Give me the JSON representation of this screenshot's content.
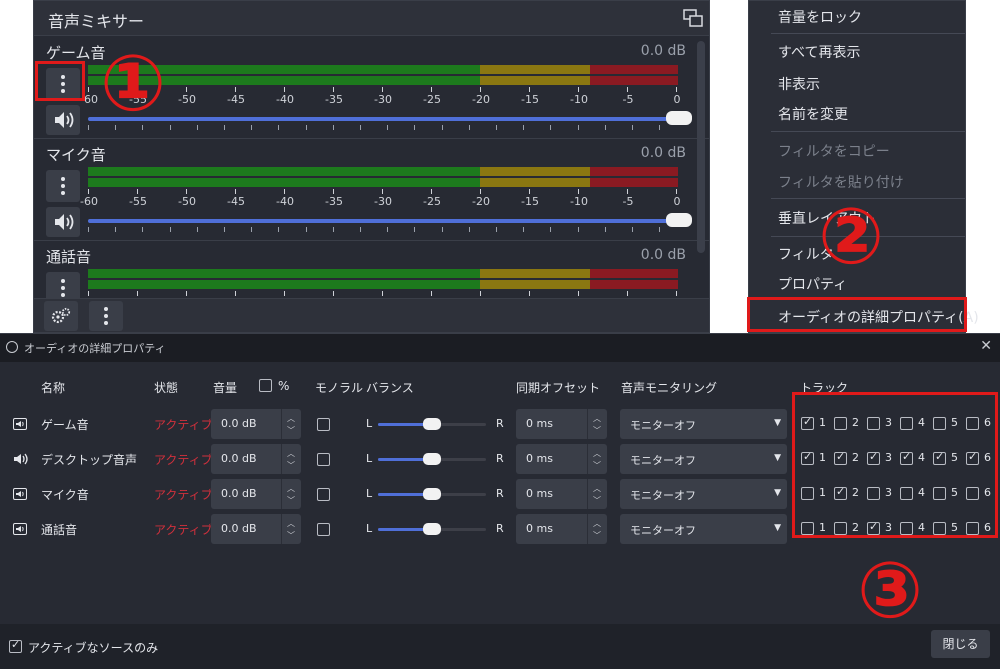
{
  "mixer": {
    "title": "音声ミキサー",
    "scale_labels": [
      "-60",
      "-55",
      "-50",
      "-45",
      "-40",
      "-35",
      "-30",
      "-25",
      "-20",
      "-15",
      "-10",
      "-5",
      "0"
    ],
    "channels": [
      {
        "name": "ゲーム音",
        "db": "0.0 dB",
        "volume_fraction": 1.0
      },
      {
        "name": "マイク音",
        "db": "0.0 dB",
        "volume_fraction": 1.0
      },
      {
        "name": "通話音",
        "db": "0.0 dB",
        "volume_fraction": 1.0
      }
    ]
  },
  "annotations": {
    "one": "①",
    "two": "②",
    "three": "③",
    "color": "#e01a1a"
  },
  "context_menu": {
    "items": [
      {
        "label": "音量をロック",
        "disabled": false
      },
      {
        "label": "すべて再表示",
        "disabled": false
      },
      {
        "label": "非表示",
        "disabled": false
      },
      {
        "label": "名前を変更",
        "disabled": false
      },
      {
        "label": "フィルタをコピー",
        "disabled": true
      },
      {
        "label": "フィルタを貼り付け",
        "disabled": true
      },
      {
        "label": "垂直レイアウト",
        "disabled": false
      },
      {
        "label": "フィルタ",
        "disabled": false
      },
      {
        "label": "プロパティ",
        "disabled": false
      },
      {
        "label": "オーディオの詳細プロパティ(A)",
        "disabled": false
      }
    ]
  },
  "dialog": {
    "title": "オーディオの詳細プロパティ",
    "close_icon": "close-icon",
    "headers": {
      "name": "名称",
      "status": "状態",
      "volume": "音量",
      "percent": "%",
      "mono": "モノラル",
      "balance": "バランス",
      "sync_offset": "同期オフセット",
      "monitoring": "音声モニタリング",
      "tracks": "トラック"
    },
    "balance_left": "L",
    "balance_right": "R",
    "rows": [
      {
        "icon": "speaker-icon",
        "name": "ゲーム音",
        "status": "アクティブ",
        "volume": "0.0 dB",
        "mono": false,
        "balance": 0.5,
        "offset": "0 ms",
        "monitoring": "モニターオフ",
        "tracks": [
          true,
          false,
          false,
          false,
          false,
          false
        ]
      },
      {
        "icon": "speaker-icon",
        "name": "デスクトップ音声",
        "status": "アクティブ",
        "volume": "0.0 dB",
        "mono": false,
        "balance": 0.5,
        "offset": "0 ms",
        "monitoring": "モニターオフ",
        "tracks": [
          true,
          true,
          true,
          true,
          true,
          true
        ]
      },
      {
        "icon": "speaker-icon",
        "name": "マイク音",
        "status": "アクティブ",
        "volume": "0.0 dB",
        "mono": false,
        "balance": 0.5,
        "offset": "0 ms",
        "monitoring": "モニターオフ",
        "tracks": [
          false,
          true,
          false,
          false,
          false,
          false
        ]
      },
      {
        "icon": "speaker-icon",
        "name": "通話音",
        "status": "アクティブ",
        "volume": "0.0 dB",
        "mono": false,
        "balance": 0.5,
        "offset": "0 ms",
        "monitoring": "モニターオフ",
        "tracks": [
          false,
          false,
          true,
          false,
          false,
          false
        ]
      }
    ],
    "track_numbers": [
      "1",
      "2",
      "3",
      "4",
      "5",
      "6"
    ],
    "active_only_label": "アクティブなソースのみ",
    "active_only_checked": true,
    "close_button": "閉じる"
  }
}
